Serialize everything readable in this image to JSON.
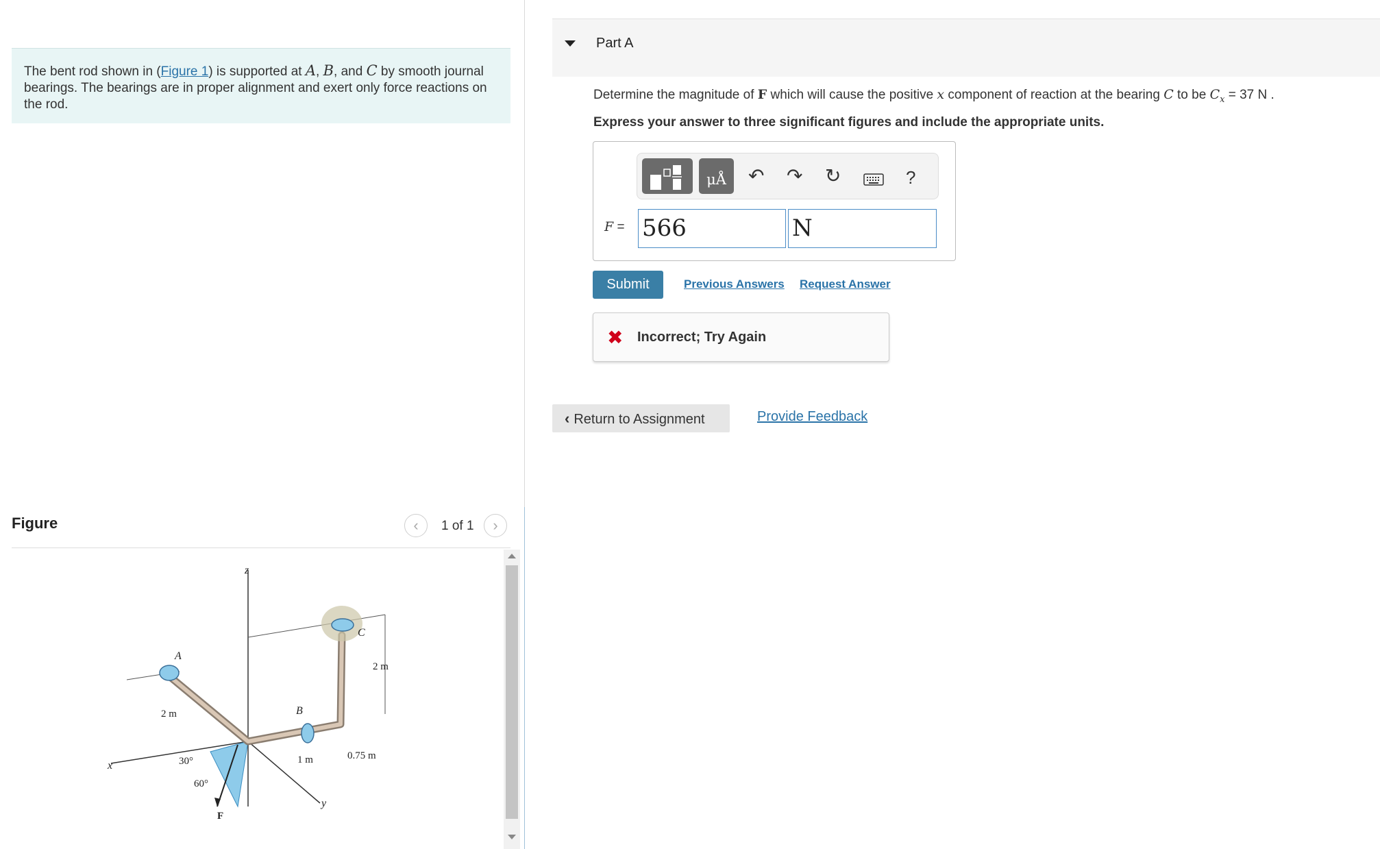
{
  "problem": {
    "text_1": "The bent rod shown in (",
    "figure_link": "Figure 1",
    "text_2": ") is supported at ",
    "var_a": "A",
    "comma_1": ", ",
    "var_b": "B",
    "text_3": ", and ",
    "var_c": "C",
    "text_4": " by smooth journal bearings. The bearings are in proper alignment and exert only force reactions on the rod."
  },
  "figure_panel": {
    "title": "Figure",
    "page_indicator": "1 of 1",
    "diagram": {
      "axis_z": "z",
      "axis_x": "x",
      "axis_y": "y",
      "label_a": "A",
      "label_b": "B",
      "label_c": "C",
      "label_force": "F",
      "dim_2m_left": "2 m",
      "dim_2m_right": "2 m",
      "dim_1m": "1 m",
      "dim_075m": "0.75 m",
      "angle_30": "30°",
      "angle_60": "60°"
    }
  },
  "part": {
    "title": "Part A",
    "question_1": "Determine the magnitude of ",
    "question_bold_var": "F",
    "question_2": " which will cause the positive ",
    "question_x": "x",
    "question_3": " component of reaction at the bearing ",
    "question_c": "C",
    "question_4": " to be ",
    "question_cx": "C",
    "question_cx_sub": "x",
    "question_5": " = 37  N .",
    "instruction": "Express your answer to three significant figures and include the appropriate units.",
    "toolbar": {
      "units_label": "μÅ",
      "help_label": "?"
    },
    "answer_label_var": "F",
    "answer_label_eq": " =",
    "answer_value": "566",
    "answer_unit": "N",
    "submit_label": "Submit",
    "previous_answers_label": "Previous Answers",
    "request_answer_label": "Request Answer",
    "feedback_message": "Incorrect; Try Again"
  },
  "footer": {
    "return_label": "Return to Assignment",
    "feedback_link": "Provide Feedback"
  }
}
